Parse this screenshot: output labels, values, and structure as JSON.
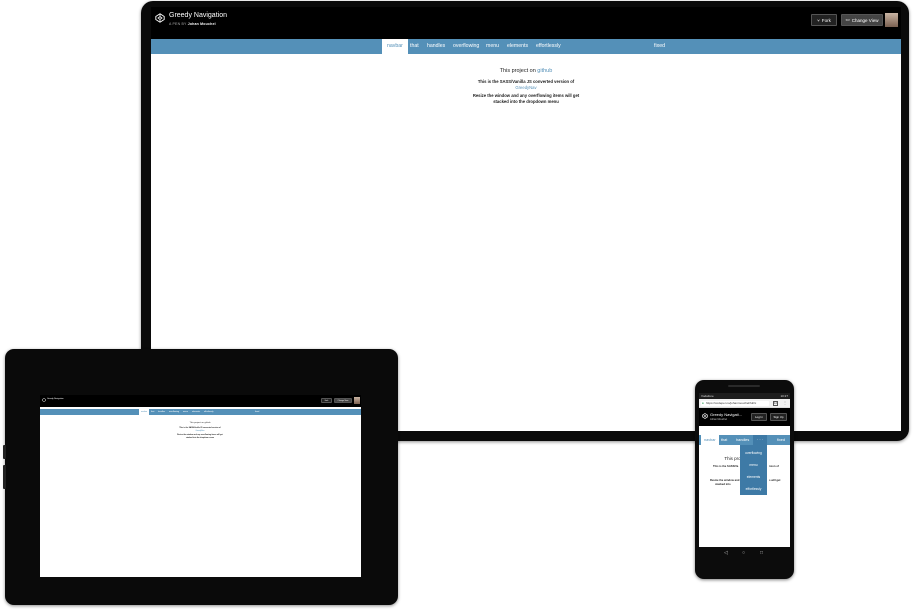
{
  "desktop": {
    "app_title": "Greedy Navigation",
    "subtitle_prefix": "A PEN BY",
    "author": "Johan Mouchel",
    "fork_label": "Fork",
    "change_view_label": "Change View",
    "nav_items": [
      "navbar",
      "that",
      "handles",
      "overflowing",
      "menu",
      "elements",
      "effortlessly"
    ],
    "nav_last": "fixed",
    "content": {
      "line1_prefix": "This project on ",
      "line1_link": "github",
      "line2_text": "This is the SASS/Vanilla JS converted version of",
      "line2_link": "GreedyNav",
      "line3_a": "Resize the window and any overflowing items will get",
      "line3_b": "stacked into the dropdown menu"
    }
  },
  "tablet": {
    "app_title": "Greedy Navigation",
    "fork_label": "Fork",
    "change_view_label": "Change View",
    "nav_items": [
      "navbar",
      "that",
      "handles",
      "overflowing",
      "menu",
      "elements",
      "effortlessly"
    ],
    "nav_last": "fixed",
    "line1": "This project on github",
    "line2": "This is the SASS/Vanilla JS converted version of",
    "line2b": "GreedyNav",
    "line3": "Resize the window and any overflowing items will get",
    "line3b": "stacked into the dropdown menu"
  },
  "phone": {
    "status_left": "Vodafone",
    "status_right": "10:27",
    "url": "https://codepen.io/johanmouchel/full/x",
    "tab_count": "12",
    "app_title": "Greedy Navigati...",
    "author": "Johan Mouchel",
    "login_label": "Log In",
    "signup_label": "Sign Up",
    "nav_items": [
      "navbar",
      "that",
      "handles"
    ],
    "more_label": "· · ·",
    "nav_last": "fixed",
    "dropdown_items": [
      "overflowing",
      "menu",
      "elements",
      "effortlessly"
    ],
    "line1": "This pro",
    "line2a": "This is the SASS/Va",
    "line2b": "rsion of",
    "line3a": "Resize the window and",
    "line3b": "s will get",
    "line3c": "stacked into",
    "nav_back": "◁",
    "nav_home": "○",
    "nav_recent": "□"
  }
}
